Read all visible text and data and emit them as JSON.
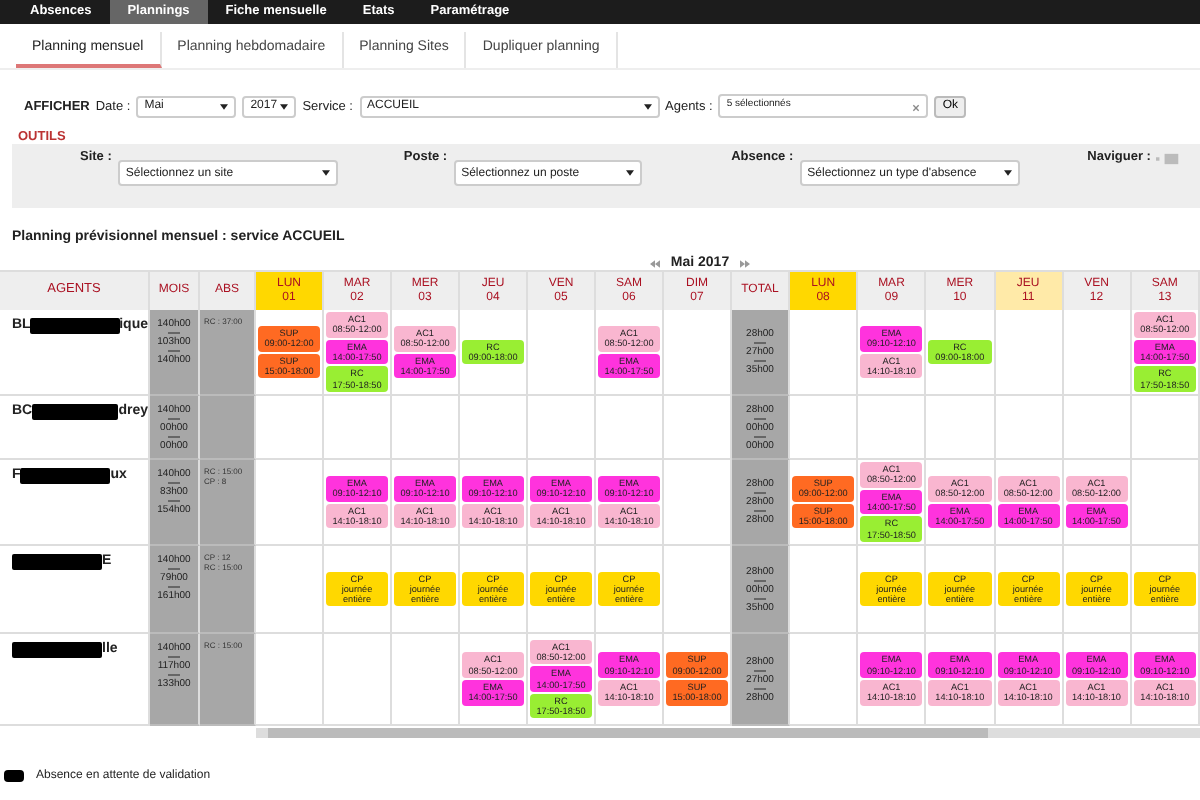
{
  "top_nav": [
    {
      "label": "Absences",
      "selected": false
    },
    {
      "label": "Plannings",
      "selected": true
    },
    {
      "label": "Fiche mensuelle",
      "selected": false
    },
    {
      "label": "Etats",
      "selected": false
    },
    {
      "label": "Paramétrage",
      "selected": false
    }
  ],
  "sub_tabs": [
    {
      "label": "Planning mensuel",
      "selected": true
    },
    {
      "label": "Planning hebdomadaire",
      "selected": false
    },
    {
      "label": "Planning Sites",
      "selected": false
    },
    {
      "label": "Dupliquer planning",
      "selected": false
    }
  ],
  "filters": {
    "title": "AFFICHER",
    "date_label": "Date :",
    "month": "Mai",
    "year": "2017",
    "service_label": "Service :",
    "service": "ACCUEIL",
    "agents_label": "Agents :",
    "agents": "5 sélectionnés",
    "ok": "Ok"
  },
  "tools": {
    "title": "OUTILS",
    "fields": [
      {
        "label": "Site :",
        "value": "Sélectionnez un site"
      },
      {
        "label": "Poste :",
        "value": "Sélectionnez un poste"
      },
      {
        "label": "Absence :",
        "value": "Sélectionnez un type d'absence"
      }
    ],
    "navigate_label": "Naviguer :"
  },
  "heading": "Planning prévisionnel mensuel : service ACCUEIL",
  "month": "Mai 2017",
  "table": {
    "columns": {
      "agents": "AGENTS",
      "mois": "MOIS",
      "abs": "ABS",
      "total": "TOTAL"
    },
    "week1": [
      {
        "day": "LUN",
        "num": "01",
        "color": "#ffd800"
      },
      {
        "day": "MAR",
        "num": "02"
      },
      {
        "day": "MER",
        "num": "03"
      },
      {
        "day": "JEU",
        "num": "04"
      },
      {
        "day": "VEN",
        "num": "05"
      },
      {
        "day": "SAM",
        "num": "06"
      },
      {
        "day": "DIM",
        "num": "07"
      }
    ],
    "week2": [
      {
        "day": "LUN",
        "num": "08",
        "color": "#ffd800"
      },
      {
        "day": "MAR",
        "num": "09"
      },
      {
        "day": "MER",
        "num": "10"
      },
      {
        "day": "JEU",
        "num": "11",
        "color": "#ffeaa8"
      },
      {
        "day": "VEN",
        "num": "12"
      },
      {
        "day": "SAM",
        "num": "13"
      }
    ],
    "rows": [
      {
        "name_start": "BL",
        "name_end": "ique",
        "mois": [
          "140h00",
          "103h00",
          "140h00"
        ],
        "abs": [
          "RC : 37:00"
        ],
        "total": [
          "28h00",
          "27h00",
          "35h00"
        ],
        "week1": [
          {
            "kind": "shifts",
            "entries": [
              {
                "code": "SUP",
                "time": "09:00-12:00",
                "color": "#ff6a22"
              },
              {
                "code": "SUP",
                "time": "15:00-18:00",
                "color": "#ff6a22"
              }
            ]
          },
          {
            "kind": "shifts",
            "entries": [
              {
                "code": "AC1",
                "time": "08:50-12:00",
                "color": "#f9b6d0"
              },
              {
                "code": "EMA",
                "time": "14:00-17:50",
                "color": "#ff33dd"
              },
              {
                "code": "RC",
                "time": "17:50-18:50",
                "color": "#99ee33"
              }
            ]
          },
          {
            "kind": "shifts",
            "entries": [
              {
                "code": "AC1",
                "time": "08:50-12:00",
                "color": "#f9b6d0"
              },
              {
                "code": "EMA",
                "time": "14:00-17:50",
                "color": "#ff33dd"
              }
            ]
          },
          {
            "kind": "shifts",
            "entries": [
              {
                "code": "RC",
                "time": "09:00-18:00",
                "color": "#99ee33"
              }
            ]
          },
          {
            "kind": "empty"
          },
          {
            "kind": "shifts",
            "entries": [
              {
                "code": "AC1",
                "time": "08:50-12:00",
                "color": "#f9b6d0"
              },
              {
                "code": "EMA",
                "time": "14:00-17:50",
                "color": "#ff33dd"
              }
            ]
          },
          {
            "kind": "empty"
          }
        ],
        "week2": [
          {
            "kind": "empty"
          },
          {
            "kind": "shifts",
            "entries": [
              {
                "code": "EMA",
                "time": "09:10-12:10",
                "color": "#ff33dd"
              },
              {
                "code": "AC1",
                "time": "14:10-18:10",
                "color": "#f9b6d0"
              }
            ]
          },
          {
            "kind": "shifts",
            "entries": [
              {
                "code": "RC",
                "time": "09:00-18:00",
                "color": "#99ee33"
              }
            ]
          },
          {
            "kind": "empty"
          },
          {
            "kind": "empty"
          },
          {
            "kind": "shifts",
            "entries": [
              {
                "code": "AC1",
                "time": "08:50-12:00",
                "color": "#f9b6d0"
              },
              {
                "code": "EMA",
                "time": "14:00-17:50",
                "color": "#ff33dd"
              },
              {
                "code": "RC",
                "time": "17:50-18:50",
                "color": "#99ee33"
              }
            ]
          }
        ]
      },
      {
        "name_start": "BC",
        "name_end": "drey",
        "mois": [
          "140h00",
          "00h00",
          "00h00"
        ],
        "total": [
          "28h00",
          "00h00",
          "00h00"
        ],
        "week1": [
          {
            "kind": "empty"
          },
          {
            "kind": "empty"
          },
          {
            "kind": "empty"
          },
          {
            "kind": "empty"
          },
          {
            "kind": "empty"
          },
          {
            "kind": "empty"
          },
          {
            "kind": "empty"
          }
        ],
        "week2": [
          {
            "kind": "empty"
          },
          {
            "kind": "empty"
          },
          {
            "kind": "empty"
          },
          {
            "kind": "empty"
          },
          {
            "kind": "empty"
          },
          {
            "kind": "empty"
          }
        ]
      },
      {
        "name_start": "F",
        "name_end": "ux",
        "mois": [
          "140h00",
          "83h00",
          "154h00"
        ],
        "abs": [
          "RC : 15:00",
          "CP : 8"
        ],
        "total": [
          "28h00",
          "28h00",
          "28h00"
        ],
        "week1": [
          {
            "kind": "empty"
          },
          {
            "kind": "shifts",
            "entries": [
              {
                "code": "EMA",
                "time": "09:10-12:10",
                "color": "#ff33dd"
              },
              {
                "code": "AC1",
                "time": "14:10-18:10",
                "color": "#f9b6d0"
              }
            ]
          },
          {
            "kind": "shifts",
            "entries": [
              {
                "code": "EMA",
                "time": "09:10-12:10",
                "color": "#ff33dd"
              },
              {
                "code": "AC1",
                "time": "14:10-18:10",
                "color": "#f9b6d0"
              }
            ]
          },
          {
            "kind": "shifts",
            "entries": [
              {
                "code": "EMA",
                "time": "09:10-12:10",
                "color": "#ff33dd"
              },
              {
                "code": "AC1",
                "time": "14:10-18:10",
                "color": "#f9b6d0"
              }
            ]
          },
          {
            "kind": "shifts",
            "entries": [
              {
                "code": "EMA",
                "time": "09:10-12:10",
                "color": "#ff33dd"
              },
              {
                "code": "AC1",
                "time": "14:10-18:10",
                "color": "#f9b6d0"
              }
            ]
          },
          {
            "kind": "shifts",
            "entries": [
              {
                "code": "EMA",
                "time": "09:10-12:10",
                "color": "#ff33dd"
              },
              {
                "code": "AC1",
                "time": "14:10-18:10",
                "color": "#f9b6d0"
              }
            ]
          },
          {
            "kind": "empty"
          }
        ],
        "week2": [
          {
            "kind": "shifts",
            "entries": [
              {
                "code": "SUP",
                "time": "09:00-12:00",
                "color": "#ff6a22"
              },
              {
                "code": "SUP",
                "time": "15:00-18:00",
                "color": "#ff6a22"
              }
            ]
          },
          {
            "kind": "shifts",
            "entries": [
              {
                "code": "AC1",
                "time": "08:50-12:00",
                "color": "#f9b6d0"
              },
              {
                "code": "EMA",
                "time": "14:00-17:50",
                "color": "#ff33dd"
              },
              {
                "code": "RC",
                "time": "17:50-18:50",
                "color": "#99ee33"
              }
            ]
          },
          {
            "kind": "shifts",
            "entries": [
              {
                "code": "AC1",
                "time": "08:50-12:00",
                "color": "#f9b6d0"
              },
              {
                "code": "EMA",
                "time": "14:00-17:50",
                "color": "#ff33dd"
              }
            ]
          },
          {
            "kind": "shifts",
            "entries": [
              {
                "code": "AC1",
                "time": "08:50-12:00",
                "color": "#f9b6d0"
              },
              {
                "code": "EMA",
                "time": "14:00-17:50",
                "color": "#ff33dd"
              }
            ]
          },
          {
            "kind": "shifts",
            "entries": [
              {
                "code": "AC1",
                "time": "08:50-12:00",
                "color": "#f9b6d0"
              },
              {
                "code": "EMA",
                "time": "14:00-17:50",
                "color": "#ff33dd"
              }
            ]
          },
          {
            "kind": "empty"
          }
        ]
      },
      {
        "name_end": "E",
        "mois": [
          "140h00",
          "79h00",
          "161h00"
        ],
        "abs": [
          "CP : 12",
          "RC : 15:00"
        ],
        "total": [
          "28h00",
          "00h00",
          "35h00"
        ],
        "week1": [
          {
            "kind": "empty"
          },
          {
            "kind": "shifts",
            "entries": [
              {
                "code": "CP",
                "time": "journée entière",
                "color": "#ffd800"
              }
            ]
          },
          {
            "kind": "shifts",
            "entries": [
              {
                "code": "CP",
                "time": "journée entière",
                "color": "#ffd800"
              }
            ]
          },
          {
            "kind": "shifts",
            "entries": [
              {
                "code": "CP",
                "time": "journée entière",
                "color": "#ffd800"
              }
            ]
          },
          {
            "kind": "shifts",
            "entries": [
              {
                "code": "CP",
                "time": "journée entière",
                "color": "#ffd800"
              }
            ]
          },
          {
            "kind": "shifts",
            "entries": [
              {
                "code": "CP",
                "time": "journée entière",
                "color": "#ffd800"
              }
            ]
          },
          {
            "kind": "empty"
          }
        ],
        "week2": [
          {
            "kind": "empty"
          },
          {
            "kind": "shifts",
            "entries": [
              {
                "code": "CP",
                "time": "journée entière",
                "color": "#ffd800"
              }
            ]
          },
          {
            "kind": "shifts",
            "entries": [
              {
                "code": "CP",
                "time": "journée entière",
                "color": "#ffd800"
              }
            ]
          },
          {
            "kind": "shifts",
            "entries": [
              {
                "code": "CP",
                "time": "journée entière",
                "color": "#ffd800"
              }
            ]
          },
          {
            "kind": "shifts",
            "entries": [
              {
                "code": "CP",
                "time": "journée entière",
                "color": "#ffd800"
              }
            ]
          },
          {
            "kind": "shifts",
            "entries": [
              {
                "code": "CP",
                "time": "journée entière",
                "color": "#ffd800"
              }
            ]
          }
        ]
      },
      {
        "name_end": "lle",
        "mois": [
          "140h00",
          "117h00",
          "133h00"
        ],
        "abs": [
          "RC : 15:00"
        ],
        "total": [
          "28h00",
          "27h00",
          "28h00"
        ],
        "week1": [
          {
            "kind": "empty"
          },
          {
            "kind": "empty"
          },
          {
            "kind": "empty"
          },
          {
            "kind": "shifts",
            "entries": [
              {
                "code": "AC1",
                "time": "08:50-12:00",
                "color": "#f9b6d0"
              },
              {
                "code": "EMA",
                "time": "14:00-17:50",
                "color": "#ff33dd"
              }
            ]
          },
          {
            "kind": "shifts",
            "entries": [
              {
                "code": "AC1",
                "time": "08:50-12:00",
                "color": "#f9b6d0"
              },
              {
                "code": "EMA",
                "time": "14:00-17:50",
                "color": "#ff33dd"
              },
              {
                "code": "RC",
                "time": "17:50-18:50",
                "color": "#99ee33"
              }
            ]
          },
          {
            "kind": "shifts",
            "entries": [
              {
                "code": "EMA",
                "time": "09:10-12:10",
                "color": "#ff33dd"
              },
              {
                "code": "AC1",
                "time": "14:10-18:10",
                "color": "#f9b6d0"
              }
            ]
          },
          {
            "kind": "shifts",
            "entries": [
              {
                "code": "SUP",
                "time": "09:00-12:00",
                "color": "#ff6a22"
              },
              {
                "code": "SUP",
                "time": "15:00-18:00",
                "color": "#ff6a22"
              }
            ]
          }
        ],
        "week2": [
          {
            "kind": "empty"
          },
          {
            "kind": "shifts",
            "entries": [
              {
                "code": "EMA",
                "time": "09:10-12:10",
                "color": "#ff33dd"
              },
              {
                "code": "AC1",
                "time": "14:10-18:10",
                "color": "#f9b6d0"
              }
            ]
          },
          {
            "kind": "shifts",
            "entries": [
              {
                "code": "EMA",
                "time": "09:10-12:10",
                "color": "#ff33dd"
              },
              {
                "code": "AC1",
                "time": "14:10-18:10",
                "color": "#f9b6d0"
              }
            ]
          },
          {
            "kind": "shifts",
            "entries": [
              {
                "code": "EMA",
                "time": "09:10-12:10",
                "color": "#ff33dd"
              },
              {
                "code": "AC1",
                "time": "14:10-18:10",
                "color": "#f9b6d0"
              }
            ]
          },
          {
            "kind": "shifts",
            "entries": [
              {
                "code": "EMA",
                "time": "09:10-12:10",
                "color": "#ff33dd"
              },
              {
                "code": "AC1",
                "time": "14:10-18:10",
                "color": "#f9b6d0"
              }
            ]
          },
          {
            "kind": "shifts",
            "entries": [
              {
                "code": "EMA",
                "time": "09:10-12:10",
                "color": "#ff33dd"
              },
              {
                "code": "AC1",
                "time": "14:10-18:10",
                "color": "#f9b6d0"
              }
            ]
          }
        ]
      }
    ]
  },
  "legend": {
    "label": "Absence en attente de validation",
    "color": "#000000"
  }
}
